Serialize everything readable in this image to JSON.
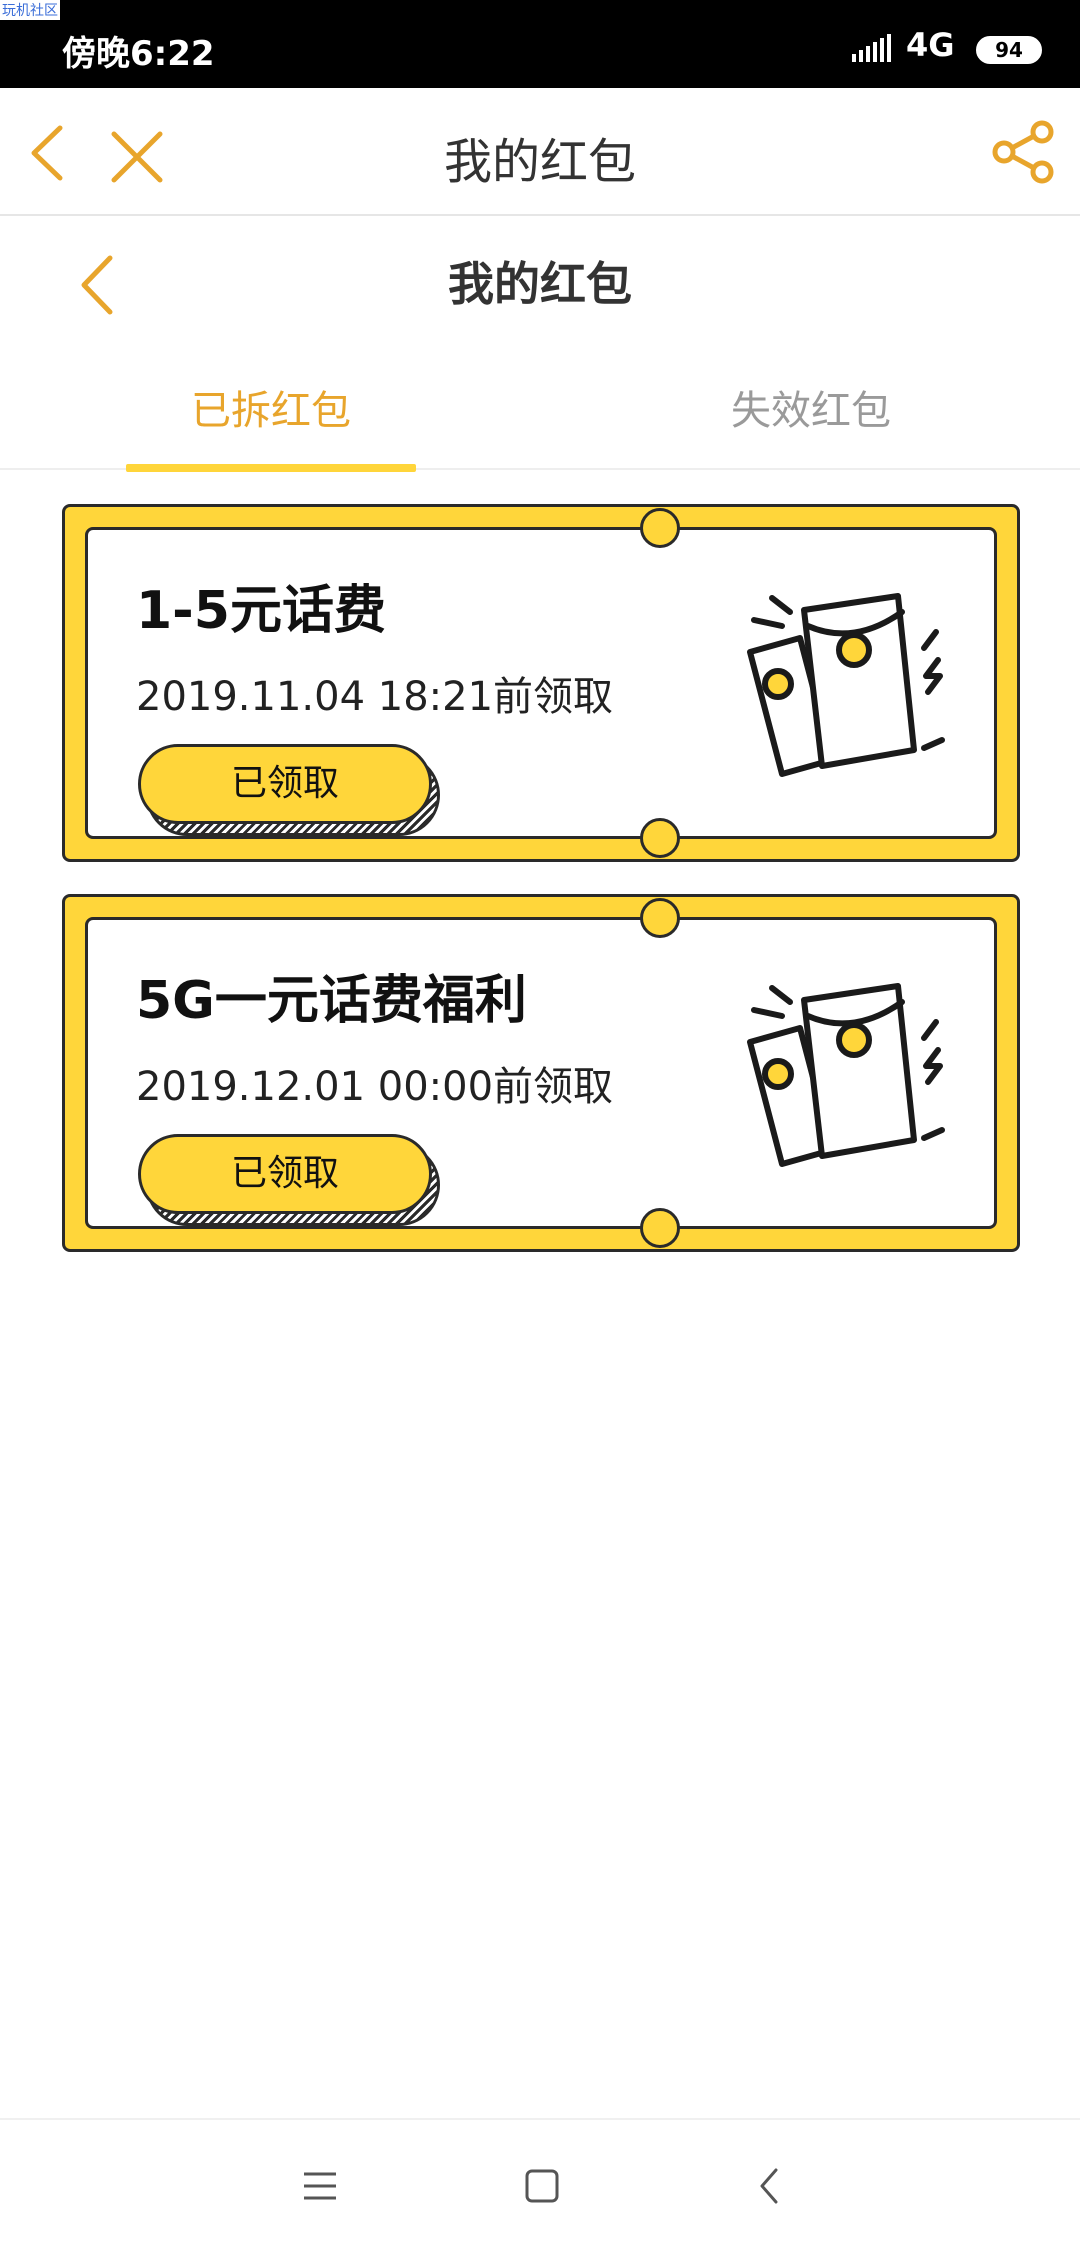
{
  "watermark": "玩机社区",
  "status_bar": {
    "time": "傍晚6:22",
    "network": "4G",
    "battery": "94"
  },
  "top_bar": {
    "title": "我的红包"
  },
  "sub_header": {
    "title": "我的红包"
  },
  "tabs": [
    {
      "label": "已拆红包",
      "active": true
    },
    {
      "label": "失效红包",
      "active": false
    }
  ],
  "coupons": [
    {
      "title": "1-5元话费",
      "deadline": "2019.11.04 18:21前领取",
      "button_label": "已领取"
    },
    {
      "title": "5G一元话费福利",
      "deadline": "2019.12.01 00:00前领取",
      "button_label": "已领取"
    }
  ],
  "colors": {
    "accent_orange": "#e8a52c",
    "coupon_yellow": "#ffd63a",
    "inactive_gray": "#9a9a9a",
    "outline_dark": "#2a2a2a"
  },
  "icons": {
    "nav_back": "back-icon",
    "nav_close": "close-icon",
    "nav_share": "share-icon",
    "system_menu": "menu-icon",
    "system_home": "home-icon",
    "system_back": "system-back-icon"
  }
}
